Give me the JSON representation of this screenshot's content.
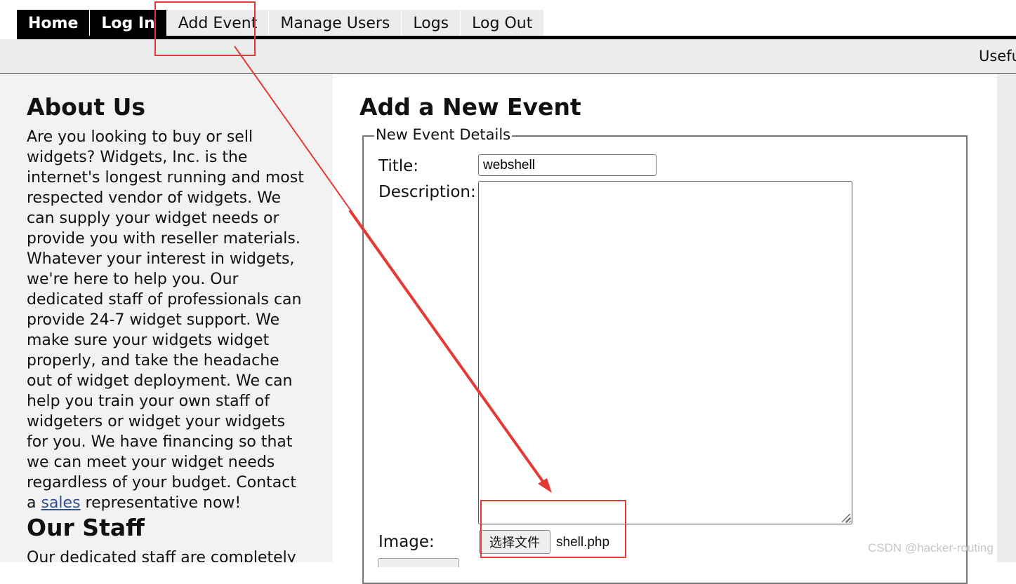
{
  "nav": {
    "items": [
      {
        "label": "Home"
      },
      {
        "label": "Log In"
      },
      {
        "label": "Add Event"
      },
      {
        "label": "Manage Users"
      },
      {
        "label": "Logs"
      },
      {
        "label": "Log Out"
      }
    ]
  },
  "subbar": {
    "text": "Usefu"
  },
  "sidebar": {
    "about_title": "About Us",
    "about_text_before_link": "Are you looking to buy or sell widgets? Widgets, Inc. is the internet's longest running and most respected vendor of widgets. We can supply your widget needs or provide you with reseller materials. Whatever your interest in widgets, we're here to help you. Our dedicated staff of professionals can provide 24-7 widget support. We make sure your widgets widget properly, and take the headache out of widget deployment. We can help you train your own staff of widgeters or widget your widgets for you. We have financing so that we can meet your widget needs regardless of your budget. Contact a",
    "about_link": "sales",
    "about_text_after_link": " representative now!",
    "staff_title": "Our Staff",
    "staff_text": "Our dedicated staff are completely"
  },
  "main": {
    "title": "Add a New Event",
    "legend": "New Event Details",
    "title_label": "Title:",
    "title_value": "webshell",
    "description_label": "Description:",
    "image_label": "Image:",
    "file_button_label": "选择文件",
    "file_name": "shell.php"
  },
  "annotation": {
    "color": "#e53935"
  },
  "watermark": "CSDN @hacker-routing"
}
